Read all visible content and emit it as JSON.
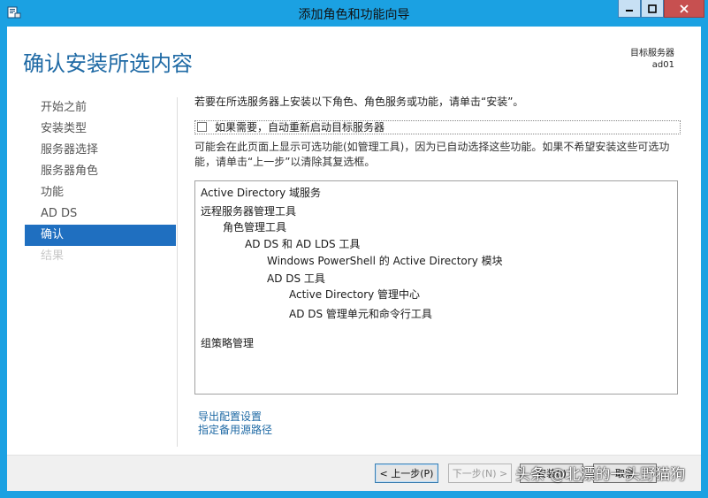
{
  "window": {
    "title": "添加角色和功能向导",
    "icon": "wizard-icon",
    "controls": [
      "minimize-icon",
      "maximize-icon",
      "close-icon"
    ]
  },
  "header": {
    "page_title": "确认安装所选内容",
    "dest_label": "目标服务器",
    "dest_server": "ad01"
  },
  "sidebar": {
    "items": [
      {
        "label": "开始之前",
        "state": "normal"
      },
      {
        "label": "安装类型",
        "state": "normal"
      },
      {
        "label": "服务器选择",
        "state": "normal"
      },
      {
        "label": "服务器角色",
        "state": "normal"
      },
      {
        "label": "功能",
        "state": "normal"
      },
      {
        "label": "AD DS",
        "state": "normal"
      },
      {
        "label": "确认",
        "state": "active"
      },
      {
        "label": "结果",
        "state": "disabled"
      }
    ]
  },
  "main": {
    "instruction": "若要在所选服务器上安装以下角色、角色服务或功能，请单击“安装”。",
    "restart_label": "如果需要，自动重新启动目标服务器",
    "restart_checked": false,
    "note": "可能会在此页面上显示可选功能(如管理工具)，因为已自动选择这些功能。如果不希望安装这些可选功能，请单击“上一步”以清除其复选框。",
    "features": [
      {
        "text": "Active Directory 域服务",
        "level": 0
      },
      {
        "text": "远程服务器管理工具",
        "level": 0
      },
      {
        "text": "角色管理工具",
        "level": 1
      },
      {
        "text": "AD DS 和 AD LDS 工具",
        "level": 2
      },
      {
        "text": "Windows PowerShell 的 Active Directory 模块",
        "level": 3
      },
      {
        "text": "AD DS 工具",
        "level": 3
      },
      {
        "text": "Active Directory 管理中心",
        "level": 4
      },
      {
        "text": "AD DS 管理单元和命令行工具",
        "level": 4
      },
      {
        "text": "组策略管理",
        "level": 0
      }
    ],
    "links": {
      "export": "导出配置设置",
      "alt_source": "指定备用源路径"
    }
  },
  "footer": {
    "prev": "< 上一步(P)",
    "next": "下一步(N) >",
    "install": "安装(I)",
    "cancel": "取消",
    "next_enabled": false
  },
  "watermark": "头条 @北漂的一头野猫狗",
  "colors": {
    "frame": "#1ba1e2",
    "title": "#1f6aa5",
    "active_nav": "#1f6fc0",
    "link": "#1f6aa5"
  }
}
